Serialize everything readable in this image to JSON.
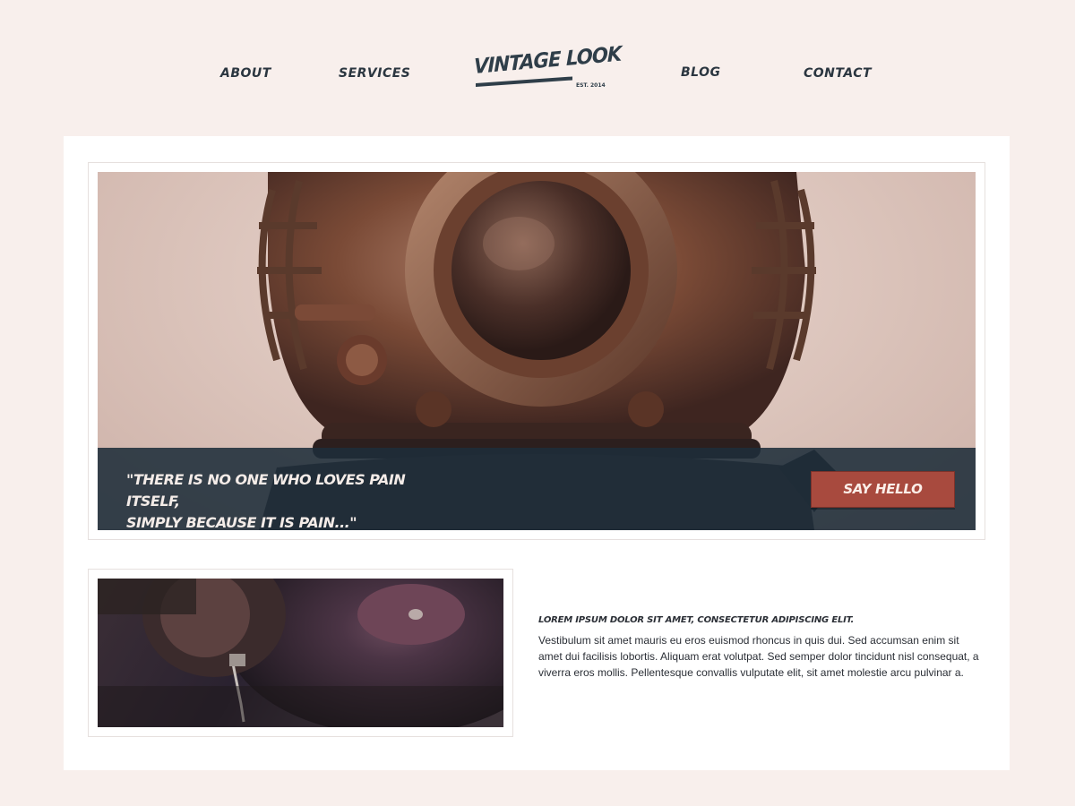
{
  "nav": {
    "about": "ABOUT",
    "services": "SERVICES",
    "blog": "BLOG",
    "contact": "CONTACT"
  },
  "logo": {
    "name": "VINTAGE LOOK",
    "est": "EST. 2014"
  },
  "hero": {
    "image": "diving-helmet-photo",
    "quote_line1": "\"There is no one who loves pain itself,",
    "quote_line2": "simply because it is pain...\"",
    "button_label": "SAY HELLO"
  },
  "article": {
    "image": "gramophone-record-photo",
    "heading": "Lorem ipsum dolor sit amet, consectetur adipiscing elit.",
    "body": "Vestibulum sit amet mauris eu eros euismod rhoncus in quis dui. Sed accumsan enim sit amet dui facilisis lobortis. Aliquam erat volutpat. Sed semper dolor tincidunt nisl consequat, a viverra eros mollis. Pellentesque convallis vulputate elit, sit amet molestie arcu pulvinar a."
  },
  "colors": {
    "background": "#f8efec",
    "dark": "#2f3e49",
    "accent": "#a84a3e",
    "overlay": "#1e2d3a"
  }
}
